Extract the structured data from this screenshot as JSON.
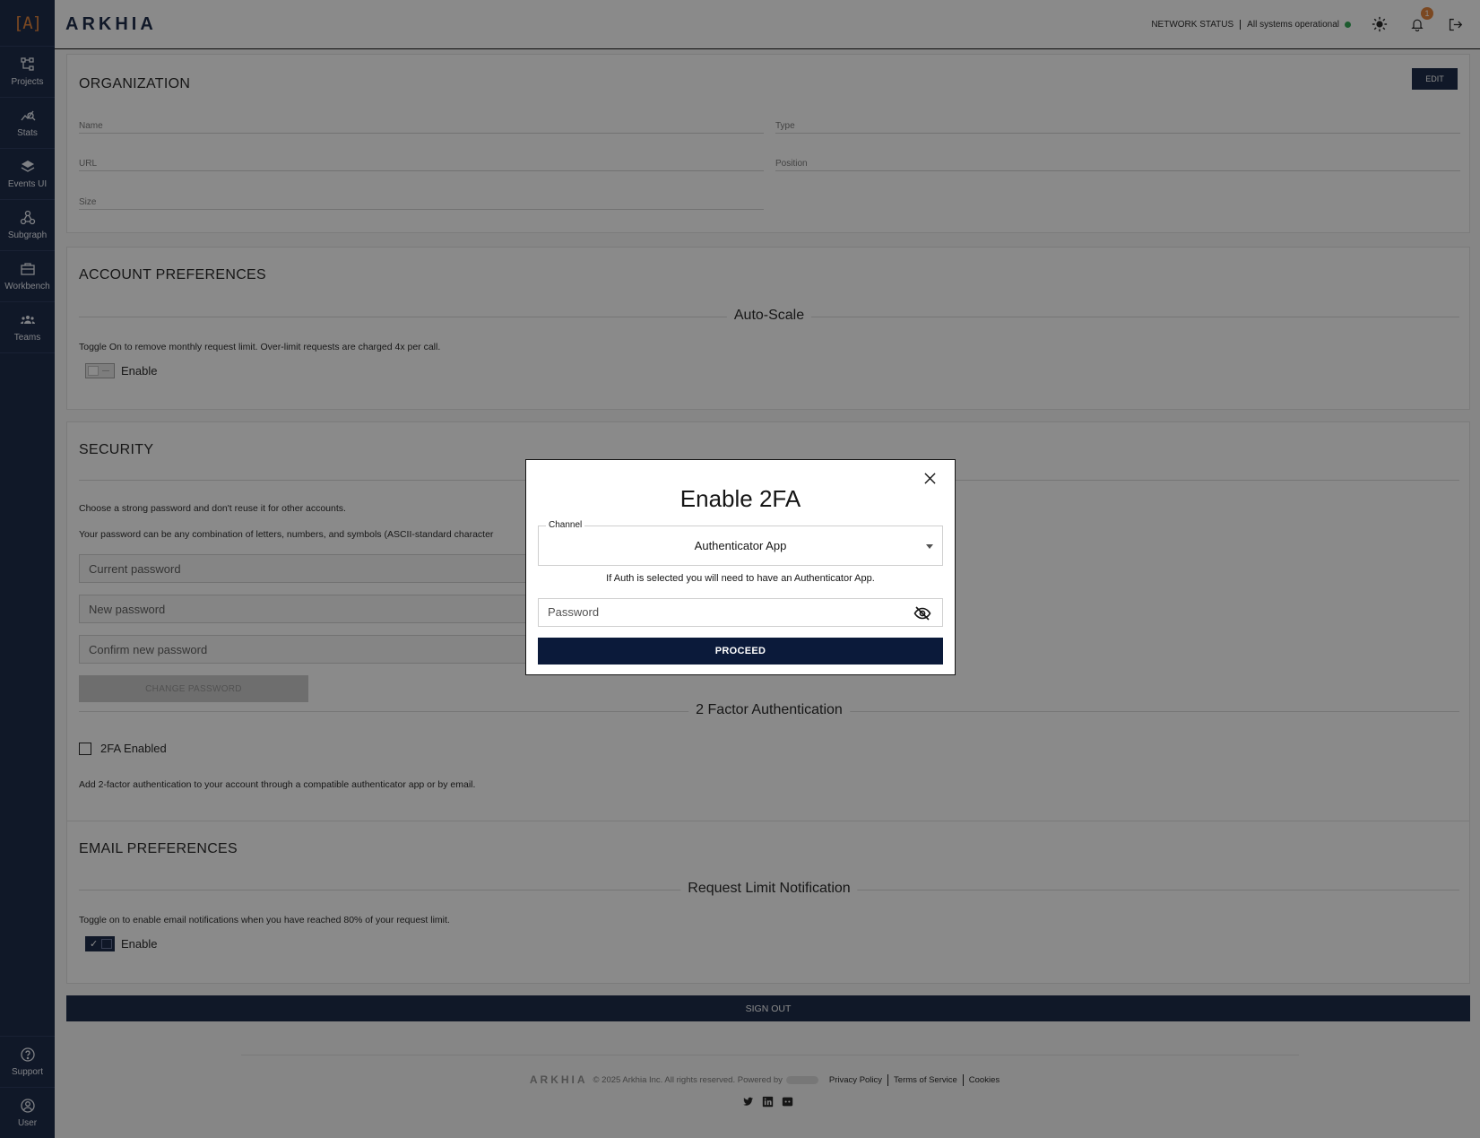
{
  "app": {
    "brand": "ARKHIA",
    "logo_mark": "[A]"
  },
  "sidebar": {
    "items": [
      {
        "label": "Projects",
        "icon": "projects-icon"
      },
      {
        "label": "Stats",
        "icon": "stats-icon"
      },
      {
        "label": "Events UI",
        "icon": "layers-icon"
      },
      {
        "label": "Subgraph",
        "icon": "subgraph-icon"
      },
      {
        "label": "Workbench",
        "icon": "briefcase-icon"
      },
      {
        "label": "Teams",
        "icon": "teams-icon"
      }
    ],
    "bottom": [
      {
        "label": "Support",
        "icon": "help-icon"
      },
      {
        "label": "User",
        "icon": "user-icon"
      }
    ]
  },
  "header": {
    "network_status_label": "NETWORK STATUS",
    "network_status_value": "All systems operational",
    "notification_count": "1",
    "icons": [
      "theme-toggle-icon",
      "bell-icon",
      "logout-icon"
    ]
  },
  "organization": {
    "title": "ORGANIZATION",
    "edit_label": "EDIT",
    "fields": {
      "name": "Name",
      "type": "Type",
      "url": "URL",
      "position": "Position",
      "size": "Size"
    }
  },
  "account_preferences": {
    "title": "ACCOUNT PREFERENCES",
    "auto_scale_heading": "Auto-Scale",
    "auto_scale_desc": "Toggle On to remove monthly request limit. Over-limit requests are charged 4x per call.",
    "toggle_label": "Enable",
    "toggle_on": false
  },
  "security": {
    "title": "SECURITY",
    "desc1": "Choose a strong password and don't reuse it for other accounts.",
    "desc2": "Your password can be any combination of letters, numbers, and symbols (ASCII-standard character",
    "current_pw_placeholder": "Current password",
    "new_pw_placeholder": "New password",
    "confirm_pw_placeholder": "Confirm new password",
    "change_button": "CHANGE PASSWORD",
    "twofa_heading": "2 Factor Authentication",
    "twofa_checkbox_label": "2FA Enabled",
    "twofa_desc": "Add 2-factor authentication to your account through a compatible authenticator app or by email."
  },
  "email_preferences": {
    "title": "EMAIL PREFERENCES",
    "heading": "Request Limit Notification",
    "desc": "Toggle on to enable email notifications when you have reached 80% of your request limit.",
    "toggle_label": "Enable",
    "toggle_on": true
  },
  "sign_out_label": "SIGN OUT",
  "footer": {
    "brand": "ARKHIA",
    "copyright": "© 2025 Arkhia Inc. All rights reserved. Powered by",
    "links": [
      "Privacy Policy",
      "Terms of Service",
      "Cookies"
    ],
    "socials": [
      "twitter-icon",
      "linkedin-icon",
      "discord-icon"
    ]
  },
  "modal": {
    "title": "Enable 2FA",
    "channel_label": "Channel",
    "channel_value": "Authenticator App",
    "helper_text": "If Auth is selected you will need to have an Authenticator App.",
    "password_placeholder": "Password",
    "proceed_label": "PROCEED"
  },
  "colors": {
    "navy": "#0b1a3a",
    "accent_orange": "#e07a2c",
    "status_green": "#24a148"
  }
}
